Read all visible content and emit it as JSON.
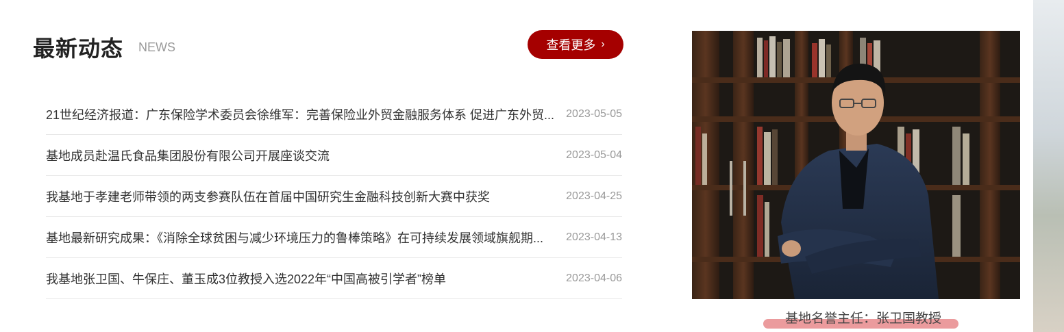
{
  "news": {
    "title": "最新动态",
    "subtitle": "NEWS",
    "more_label": "查看更多",
    "more_icon": "chevron-right-icon",
    "items": [
      {
        "title": "21世纪经济报道：广东保险学术委员会徐维军：完善保险业外贸金融服务体系 促进广东外贸...",
        "date": "2023-05-05"
      },
      {
        "title": "基地成员赴温氏食品集团股份有限公司开展座谈交流",
        "date": "2023-05-04"
      },
      {
        "title": "我基地于孝建老师带领的两支参赛队伍在首届中国研究生金融科技创新大赛中获奖",
        "date": "2023-04-25"
      },
      {
        "title": "基地最新研究成果：《消除全球贫困与减少环境压力的鲁棒策略》在可持续发展领域旗舰期...",
        "date": "2023-04-13"
      },
      {
        "title": "我基地张卫国、牛保庄、董玉成3位教授入选2022年“中国高被引学者”榜单",
        "date": "2023-04-06"
      }
    ]
  },
  "feature": {
    "caption": "基地名誉主任：张卫国教授"
  },
  "colors": {
    "accent": "#a50000",
    "caption_underline": "#e88a8c"
  }
}
